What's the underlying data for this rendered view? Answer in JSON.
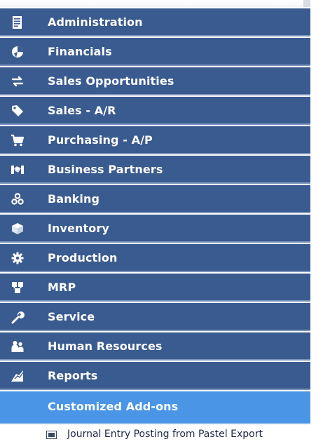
{
  "menu": {
    "items": [
      {
        "label": "Administration",
        "icon": "document-icon"
      },
      {
        "label": "Financials",
        "icon": "financials-icon"
      },
      {
        "label": "Sales Opportunities",
        "icon": "sales-opportunities-icon"
      },
      {
        "label": "Sales - A/R",
        "icon": "price-tag-icon"
      },
      {
        "label": "Purchasing - A/P",
        "icon": "shopping-cart-icon"
      },
      {
        "label": "Business Partners",
        "icon": "business-partners-icon"
      },
      {
        "label": "Banking",
        "icon": "coins-icon"
      },
      {
        "label": "Inventory",
        "icon": "box-icon"
      },
      {
        "label": "Production",
        "icon": "gear-icon"
      },
      {
        "label": "MRP",
        "icon": "mrp-icon"
      },
      {
        "label": "Service",
        "icon": "wrench-icon"
      },
      {
        "label": "Human Resources",
        "icon": "people-icon"
      },
      {
        "label": "Reports",
        "icon": "chart-icon"
      },
      {
        "label": "Customized Add-ons",
        "icon": "",
        "selected": true
      }
    ],
    "subitems": [
      {
        "label": "Journal Entry Posting from Pastel Export",
        "icon": "form-icon"
      }
    ]
  },
  "colors": {
    "item_bg": "#3a5b8f",
    "item_separator": "#7b95bd",
    "selected_bg": "#4a95e6",
    "text": "#ffffff"
  }
}
